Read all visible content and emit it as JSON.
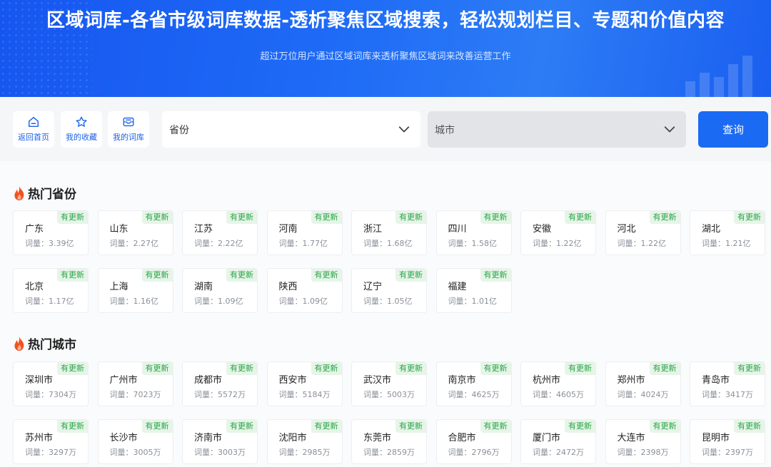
{
  "banner": {
    "title": "区域词库-各省市级词库数据-透析聚焦区域搜索，轻松规划栏目、专题和价值内容",
    "subtitle": "超过万位用户通过区域词库来透析聚焦区域词来改善运营工作"
  },
  "toolbar": {
    "home_label": "返回首页",
    "favorites_label": "我的收藏",
    "library_label": "我的词库",
    "province_placeholder": "省份",
    "city_placeholder": "城市",
    "query_label": "查询"
  },
  "hot_provinces": {
    "title": "热门省份",
    "items": [
      {
        "name": "广东",
        "count": "词量：3.39亿",
        "badge": "有更新"
      },
      {
        "name": "山东",
        "count": "词量：2.27亿",
        "badge": "有更新"
      },
      {
        "name": "江苏",
        "count": "词量：2.22亿",
        "badge": "有更新"
      },
      {
        "name": "河南",
        "count": "词量：1.77亿",
        "badge": "有更新"
      },
      {
        "name": "浙江",
        "count": "词量：1.68亿",
        "badge": "有更新"
      },
      {
        "name": "四川",
        "count": "词量：1.58亿",
        "badge": "有更新"
      },
      {
        "name": "安徽",
        "count": "词量：1.22亿",
        "badge": "有更新"
      },
      {
        "name": "河北",
        "count": "词量：1.22亿",
        "badge": "有更新"
      },
      {
        "name": "湖北",
        "count": "词量：1.21亿",
        "badge": "有更新"
      },
      {
        "name": "北京",
        "count": "词量：1.17亿",
        "badge": "有更新"
      },
      {
        "name": "上海",
        "count": "词量：1.16亿",
        "badge": "有更新"
      },
      {
        "name": "湖南",
        "count": "词量：1.09亿",
        "badge": "有更新"
      },
      {
        "name": "陕西",
        "count": "词量：1.09亿",
        "badge": "有更新"
      },
      {
        "name": "辽宁",
        "count": "词量：1.05亿",
        "badge": "有更新"
      },
      {
        "name": "福建",
        "count": "词量：1.01亿",
        "badge": "有更新"
      }
    ]
  },
  "hot_cities": {
    "title": "热门城市",
    "items": [
      {
        "name": "深圳市",
        "count": "词量：7304万",
        "badge": "有更新"
      },
      {
        "name": "广州市",
        "count": "词量：7023万",
        "badge": "有更新"
      },
      {
        "name": "成都市",
        "count": "词量：5572万",
        "badge": "有更新"
      },
      {
        "name": "西安市",
        "count": "词量：5184万",
        "badge": "有更新"
      },
      {
        "name": "武汉市",
        "count": "词量：5003万",
        "badge": "有更新"
      },
      {
        "name": "南京市",
        "count": "词量：4625万",
        "badge": "有更新"
      },
      {
        "name": "杭州市",
        "count": "词量：4605万",
        "badge": "有更新"
      },
      {
        "name": "郑州市",
        "count": "词量：4024万",
        "badge": "有更新"
      },
      {
        "name": "青岛市",
        "count": "词量：3417万",
        "badge": "有更新"
      },
      {
        "name": "苏州市",
        "count": "词量：3297万",
        "badge": "有更新"
      },
      {
        "name": "长沙市",
        "count": "词量：3005万",
        "badge": "有更新"
      },
      {
        "name": "济南市",
        "count": "词量：3003万",
        "badge": "有更新"
      },
      {
        "name": "沈阳市",
        "count": "词量：2985万",
        "badge": "有更新"
      },
      {
        "name": "东莞市",
        "count": "词量：2859万",
        "badge": "有更新"
      },
      {
        "name": "合肥市",
        "count": "词量：2796万",
        "badge": "有更新"
      },
      {
        "name": "厦门市",
        "count": "词量：2472万",
        "badge": "有更新"
      },
      {
        "name": "大连市",
        "count": "词量：2398万",
        "badge": "有更新"
      },
      {
        "name": "昆明市",
        "count": "词量：2397万",
        "badge": "有更新"
      }
    ]
  },
  "colors": {
    "brand": "#1a6af3",
    "badge_bg": "#e6f5e8",
    "badge_text": "#29a546",
    "fire": "#f4511e"
  },
  "icons": {
    "home": "home-icon",
    "favorites": "star-icon",
    "library": "inbox-icon",
    "fire": "fire-icon",
    "dropdown": "chevron-down-icon"
  }
}
